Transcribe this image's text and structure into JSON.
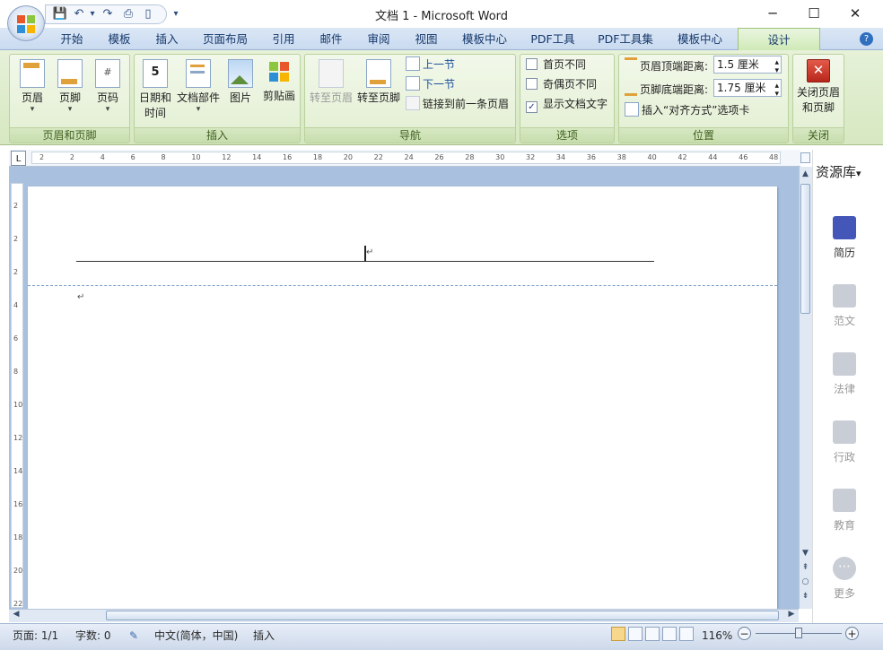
{
  "window": {
    "title": "文档 1 - Microsoft Word",
    "minimize": "─",
    "maximize": "☐",
    "close": "✕"
  },
  "quick_access": {
    "save": "💾",
    "undo": "↶",
    "undo_arrow": "▾",
    "redo": "↷",
    "print": "⎙",
    "view": "▯",
    "customize": "▾"
  },
  "tabs": [
    "开始",
    "模板",
    "插入",
    "页面布局",
    "引用",
    "邮件",
    "审阅",
    "视图",
    "模板中心",
    "PDF工具",
    "PDF工具集",
    "模板中心",
    "设计"
  ],
  "help": "?",
  "ribbon": {
    "header_footer_group": {
      "label": "页眉和页脚",
      "header": "页眉",
      "footer": "页脚",
      "page_number": "页码",
      "arrow": "▾"
    },
    "insert_group": {
      "label": "插入",
      "datetime_line1": "日期和",
      "datetime_line2": "时间",
      "doc_parts": "文档部件",
      "picture": "图片",
      "clipart": "剪贴画",
      "arrow": "▾"
    },
    "nav_group": {
      "label": "导航",
      "goto_header": "转至页眉",
      "goto_footer": "转至页脚",
      "prev_section": "上一节",
      "next_section": "下一节",
      "link_previous": "链接到前一条页眉"
    },
    "options_group": {
      "label": "选项",
      "first_page_diff": "首页不同",
      "odd_even_diff": "奇偶页不同",
      "show_doc_text": "显示文档文字",
      "show_doc_text_checked": "✓"
    },
    "position_group": {
      "label": "位置",
      "header_top_label": "页眉顶端距离:",
      "header_top_value": "1.5 厘米",
      "footer_bottom_label": "页脚底端距离:",
      "footer_bottom_value": "1.75 厘米",
      "insert_align_tab": "插入“对齐方式”选项卡",
      "spin_up": "▴",
      "spin_down": "▾"
    },
    "close_group": {
      "label": "关闭",
      "close_line1": "关闭页眉",
      "close_line2": "和页脚"
    }
  },
  "ruler": {
    "tab_selector": "L",
    "ticks": [
      "2",
      "2",
      "4",
      "6",
      "8",
      "10",
      "12",
      "14",
      "16",
      "18",
      "20",
      "22",
      "24",
      "26",
      "28",
      "30",
      "32",
      "34",
      "36",
      "38",
      "40",
      "42",
      "44",
      "46",
      "48"
    ],
    "vticks": [
      "2",
      "2",
      "2",
      "4",
      "6",
      "8",
      "10",
      "12",
      "14",
      "16",
      "18",
      "20",
      "22"
    ]
  },
  "document": {
    "paragraph_mark": "↵"
  },
  "statusbar": {
    "page": "页面: 1/1",
    "words": "字数: 0",
    "language": "中文(简体，中国)",
    "mode": "插入",
    "zoom": "116%",
    "zoom_out": "−",
    "zoom_in": "+"
  },
  "right_panel": {
    "title": "资源库",
    "title_arrow": "▾",
    "items": [
      "简历",
      "范文",
      "法律",
      "行政",
      "教育",
      "更多"
    ],
    "active_color": "#4457b8",
    "inactive_color": "#c5c9d2"
  },
  "scroll": {
    "up": "▲",
    "down": "▼",
    "left": "◀",
    "right": "▶",
    "prev_page": "⇞",
    "browse": "○",
    "next_page": "⇟"
  }
}
